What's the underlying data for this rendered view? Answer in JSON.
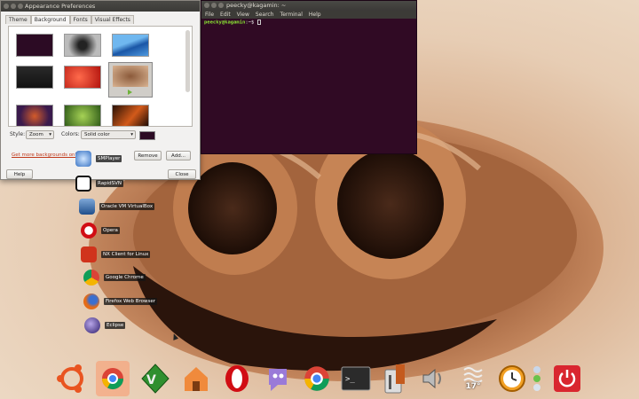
{
  "appearance_window": {
    "title": "Appearance Preferences",
    "tabs": [
      "Theme",
      "Background",
      "Fonts",
      "Visual Effects"
    ],
    "style_label": "Style:",
    "style_value": "Zoom",
    "colors_label": "Colors:",
    "colors_value": "Solid color",
    "color_swatch": "#2c0b24",
    "get_more_link": "Get more backgrounds online",
    "remove_button": "Remove",
    "add_button": "Add...",
    "help_button": "Help",
    "close_button": "Close"
  },
  "terminal": {
    "title": "peecky@kagamin: ~",
    "menu": [
      "File",
      "Edit",
      "View",
      "Search",
      "Terminal",
      "Help"
    ],
    "prompt_user": "peecky@kagamin",
    "prompt_rest": ":~$ ",
    "background": "#300a24"
  },
  "launchers": [
    {
      "label": "SMPlayer",
      "icon": "smplayer-icon"
    },
    {
      "label": "RapidSVN",
      "icon": "rapidsvn-icon"
    },
    {
      "label": "Oracle VM VirtualBox",
      "icon": "virtualbox-icon"
    },
    {
      "label": "Opera",
      "icon": "opera-icon"
    },
    {
      "label": "NX Client for Linux",
      "icon": "nx-client-icon"
    },
    {
      "label": "Google Chrome",
      "icon": "chrome-icon"
    },
    {
      "label": "Firefox Web Browser",
      "icon": "firefox-icon"
    },
    {
      "label": "Eclipse",
      "icon": "eclipse-icon"
    }
  ],
  "dock": {
    "weather_temp": "17°",
    "items": [
      "ubuntu-icon",
      "chrome-icon",
      "vim-icon",
      "home-folder-icon",
      "opera-icon",
      "pidgin-icon",
      "chrome-icon",
      "terminal-icon",
      "system-tools-icon",
      "volume-icon",
      "weather-icon",
      "clock-icon",
      "system-monitor-icon",
      "power-icon"
    ]
  }
}
